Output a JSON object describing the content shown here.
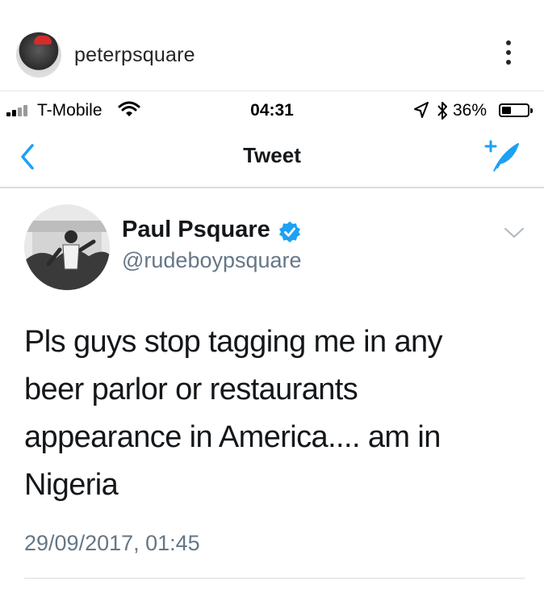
{
  "instagram": {
    "username": "peterpsquare"
  },
  "status_bar": {
    "carrier": "T-Mobile",
    "time": "04:31",
    "battery_percent": "36%",
    "battery_level": 0.36
  },
  "nav": {
    "title": "Tweet"
  },
  "tweet": {
    "author_name": "Paul Psquare",
    "handle": "@rudeboypsquare",
    "text_lines": [
      "Pls guys stop tagging me in any",
      "beer parlor or restaurants",
      "appearance in America.... am in",
      "Nigeria"
    ],
    "timestamp": "29/09/2017, 01:45"
  },
  "colors": {
    "twitter_blue": "#1da1f2",
    "secondary_text": "#657786",
    "primary_text": "#14171a"
  },
  "icons": {
    "more": "more-vertical-icon",
    "signal": "cellular-signal-icon",
    "wifi": "wifi-icon",
    "location": "location-arrow-icon",
    "bluetooth": "bluetooth-icon",
    "battery": "battery-icon",
    "back": "chevron-left-icon",
    "compose": "compose-tweet-icon",
    "verified": "verified-badge-icon",
    "caret": "chevron-down-icon"
  }
}
